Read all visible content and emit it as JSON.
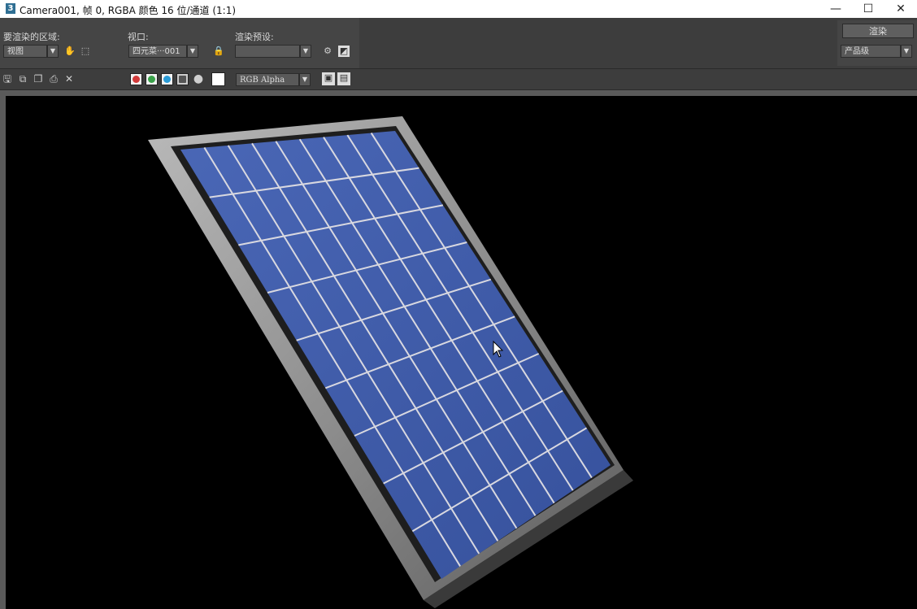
{
  "window": {
    "title": "Camera001, 帧 0, RGBA 颜色 16 位/通道 (1:1)",
    "app_icon_glyph": "3",
    "controls": {
      "minimize": "—",
      "maximize": "☐",
      "close": "✕"
    }
  },
  "render_setup": {
    "area_label": "要渲染的区域:",
    "area_value": "视图",
    "viewport_label": "视口:",
    "viewport_value": "四元菜···001",
    "preset_label": "渲染预设:",
    "preset_value": "",
    "render_button": "渲染",
    "quality_value": "产品级"
  },
  "frame_toolbar": {
    "channel_display": "RGB Alpha",
    "icons": [
      "save-icon",
      "copy-icon",
      "clone-window-icon",
      "print-icon",
      "clear-icon"
    ],
    "channels": {
      "red": "#d23a3a",
      "green": "#3aa24a",
      "blue": "#2a9bd6",
      "alpha": "#666666"
    }
  },
  "viewport": {
    "background": "#000000",
    "object": "solar panel",
    "panel_cell_color": "#3f5aa8",
    "panel_frame_color": "#8a8a8a",
    "grid_columns": 9,
    "grid_rows": 9
  }
}
